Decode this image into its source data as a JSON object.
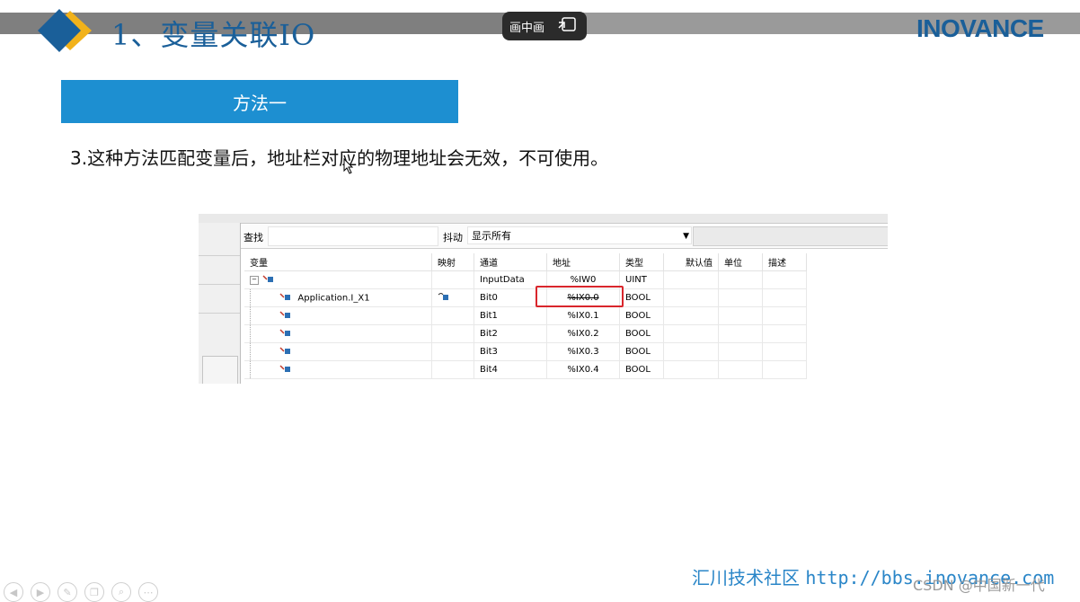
{
  "header": {
    "title": "1、变量关联IO",
    "brand": "INOVANCE",
    "pip_label": "画中画",
    "colors": {
      "title": "#1a5f99",
      "band": "#7f7f7f",
      "diamond_blue": "#1a5f99",
      "diamond_yellow": "#f2b21a"
    }
  },
  "slide": {
    "method_label": "方法一",
    "body_text": "3.这种方法匹配变量后，地址栏对应的物理地址会无效，不可使用。",
    "accent": "#1d8fd1"
  },
  "screenshot": {
    "search_label": "查找",
    "filter_label": "抖动",
    "filter_value": "显示所有",
    "columns": [
      "变量",
      "映射",
      "通道",
      "地址",
      "类型",
      "默认值",
      "单位",
      "描述"
    ],
    "rows": [
      {
        "variable": "",
        "mapping": "",
        "channel": "InputData",
        "address": "%IW0",
        "type": "UINT"
      },
      {
        "variable": "Application.I_X1",
        "mapping": "",
        "channel": "Bit0",
        "address": "%IX0.0",
        "type": "BOOL"
      },
      {
        "variable": "",
        "mapping": "",
        "channel": "Bit1",
        "address": "%IX0.1",
        "type": "BOOL"
      },
      {
        "variable": "",
        "mapping": "",
        "channel": "Bit2",
        "address": "%IX0.2",
        "type": "BOOL"
      },
      {
        "variable": "",
        "mapping": "",
        "channel": "Bit3",
        "address": "%IX0.3",
        "type": "BOOL"
      },
      {
        "variable": "",
        "mapping": "",
        "channel": "Bit4",
        "address": "%IX0.4",
        "type": "BOOL"
      }
    ],
    "highlight_color": "#d9262c"
  },
  "footer": {
    "community": "汇川技术社区",
    "url": "http://bbs.inovance.com",
    "watermark": "CSDN @中国新一代"
  },
  "controls": [
    "prev-icon",
    "play-icon",
    "pen-icon",
    "copy-icon",
    "zoom-icon",
    "more-icon"
  ]
}
